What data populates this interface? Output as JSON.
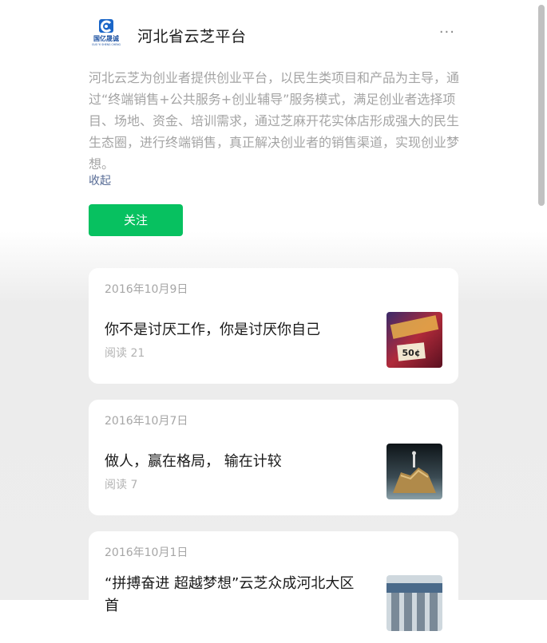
{
  "account": {
    "logo_text": "国亿晟诚",
    "logo_subtext": "GUO YI SHENG CHENG",
    "name": "河北省云芝平台",
    "more_label": "···",
    "description": "河北云芝为创业者提供创业平台，以民生类项目和产品为主导，通过“终端销售+公共服务+创业辅导”服务模式，满足创业者选择项目、场地、资金、培训需求，通过芝麻开花实体店形成强大的民生生态圈，进行终端销售，真正解决创业者的销售渠道，实现创业梦想。",
    "collapse_label": "收起",
    "follow_label": "关注"
  },
  "articles": [
    {
      "date": "2016年10月9日",
      "title": "你不是讨厌工作，你是讨厌你自己",
      "reads": "阅读 21",
      "thumb_icon": "price-tag-thumbnail"
    },
    {
      "date": "2016年10月7日",
      "title": "做人，赢在格局， 输在计较",
      "reads": "阅读 7",
      "thumb_icon": "figure-on-rock-thumbnail"
    },
    {
      "date": "2016年10月1日",
      "title": "“拼搏奋进 超越梦想”云芝众成河北大区首",
      "reads": "",
      "thumb_icon": "building-thumbnail"
    }
  ],
  "colors": {
    "accent": "#07c160",
    "link": "#576b95",
    "desc_text": "#a4a4a4"
  }
}
